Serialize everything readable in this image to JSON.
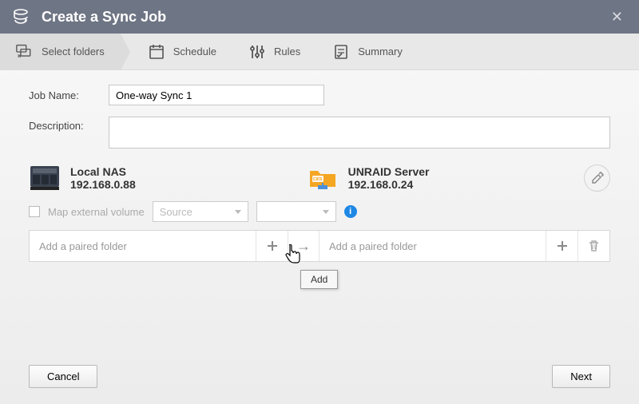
{
  "title": "Create a Sync Job",
  "steps": {
    "select_folders": "Select folders",
    "schedule": "Schedule",
    "rules": "Rules",
    "summary": "Summary"
  },
  "form": {
    "job_name_label": "Job Name:",
    "job_name_value": "One-way Sync 1",
    "description_label": "Description:",
    "description_value": ""
  },
  "hosts": {
    "local": {
      "name": "Local NAS",
      "ip": "192.168.0.88"
    },
    "remote": {
      "name": "UNRAID Server",
      "ip": "192.168.0.24"
    }
  },
  "map": {
    "checkbox_label": "Map external volume",
    "source_placeholder": "Source",
    "target_placeholder": ""
  },
  "pair": {
    "left_placeholder": "Add a paired folder",
    "right_placeholder": "Add a paired folder"
  },
  "tooltip": {
    "add": "Add"
  },
  "buttons": {
    "cancel": "Cancel",
    "next": "Next"
  }
}
